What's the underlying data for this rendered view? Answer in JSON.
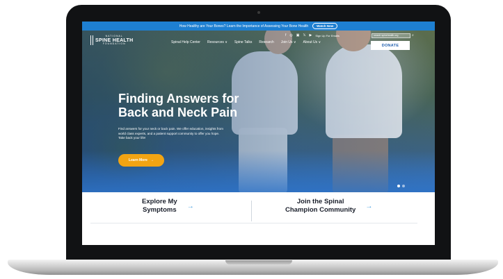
{
  "banner": {
    "text": "How Healthy are Your Bones? Learn the Importance of Assessing Your Bone Health",
    "button": "Watch Now"
  },
  "logo": {
    "small_top": "NATIONAL",
    "name": "SPINE HEALTH",
    "small_bottom": "FOUNDATION"
  },
  "nav": {
    "items": [
      "Spinal Help Center",
      "Resources ∨",
      "Spine Talks",
      "Research",
      "Join Us ∨",
      "About Us ∨"
    ],
    "donate": "DONATE",
    "signup": "Sign Up For Emails",
    "search_placeholder": "search spinehealth.org"
  },
  "social": [
    "f",
    "◎",
    "▣",
    "𝕏",
    "▶"
  ],
  "hero": {
    "title": "Finding Answers for Back and Neck Pain",
    "description": "Find answers for your neck or back pain. We offer education, insights from world class experts, and a patient support community to offer you hope. Take back your life!",
    "button": "Learn More",
    "button_arrow": "→"
  },
  "cards": [
    {
      "title_line1": "Explore My",
      "title_line2": "Symptoms",
      "arrow": "→"
    },
    {
      "title_line1": "Join the Spinal",
      "title_line2": "Champion Community",
      "arrow": "→"
    }
  ]
}
